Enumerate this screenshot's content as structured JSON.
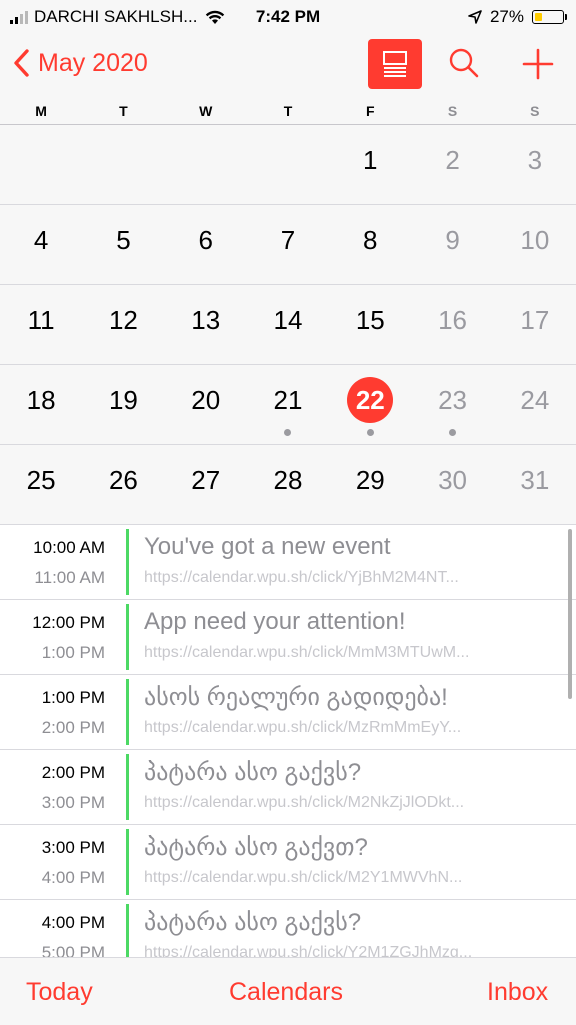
{
  "status_bar": {
    "carrier": "DARCHI SAKHLSH...",
    "time": "7:42 PM",
    "battery_percent": "27%",
    "battery_level": 0.27
  },
  "nav": {
    "back_label": "May 2020",
    "accent_color": "#ff3b30"
  },
  "weekdays": [
    "M",
    "T",
    "W",
    "T",
    "F",
    "S",
    "S"
  ],
  "calendar": {
    "weeks": [
      [
        "",
        "",
        "",
        "",
        "1",
        "2",
        "3"
      ],
      [
        "4",
        "5",
        "6",
        "7",
        "8",
        "9",
        "10"
      ],
      [
        "11",
        "12",
        "13",
        "14",
        "15",
        "16",
        "17"
      ],
      [
        "18",
        "19",
        "20",
        "21",
        "22",
        "23",
        "24"
      ],
      [
        "25",
        "26",
        "27",
        "28",
        "29",
        "30",
        "31"
      ]
    ],
    "selected_day": "22",
    "days_with_events": [
      "21",
      "22",
      "23"
    ]
  },
  "events": [
    {
      "start": "10:00 AM",
      "end": "11:00 AM",
      "title": "You've got a new event",
      "url": "https://calendar.wpu.sh/click/YjBhM2M4NT..."
    },
    {
      "start": "12:00 PM",
      "end": "1:00 PM",
      "title": "App need your attention!",
      "url": "https://calendar.wpu.sh/click/MmM3MTUwM..."
    },
    {
      "start": "1:00 PM",
      "end": "2:00 PM",
      "title": "ასოს რეალური გადიდება!",
      "url": "https://calendar.wpu.sh/click/MzRmMmEyY..."
    },
    {
      "start": "2:00 PM",
      "end": "3:00 PM",
      "title": "პატარა ასო გაქვს?",
      "url": "https://calendar.wpu.sh/click/M2NkZjJlODkt..."
    },
    {
      "start": "3:00 PM",
      "end": "4:00 PM",
      "title": "პატარა ასო გაქვთ?",
      "url": "https://calendar.wpu.sh/click/M2Y1MWVhN..."
    },
    {
      "start": "4:00 PM",
      "end": "5:00 PM",
      "title": "პატარა ასო გაქვს?",
      "url": "https://calendar.wpu.sh/click/Y2M1ZGJhMzg..."
    }
  ],
  "tabbar": {
    "today": "Today",
    "calendars": "Calendars",
    "inbox": "Inbox"
  },
  "icons": {
    "list_view": "list-view-icon",
    "search": "search-icon",
    "add": "plus-icon",
    "back": "chevron-left-icon"
  }
}
